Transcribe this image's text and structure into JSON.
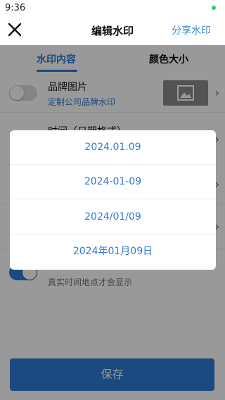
{
  "status_bar": {
    "time": "9:36"
  },
  "nav": {
    "title": "编辑水印",
    "share_label": "分享水印",
    "close_icon": "close-icon"
  },
  "tabs": {
    "active": "水印内容",
    "inactive": "颜色大小"
  },
  "rows": [
    {
      "label": "品牌图片",
      "sub": "定制公司品牌水印",
      "toggle_on": false
    },
    {
      "label": "时间（日期格式）"
    },
    {
      "sub": "真实时间地点才会显示",
      "toggle_on": true
    }
  ],
  "dialog": {
    "options": [
      "2024.01.09",
      "2024-01-09",
      "2024/01/09",
      "2024年01月09日"
    ]
  },
  "save_label": "保存",
  "colors": {
    "accent": "#2d7ad6",
    "overlay": "rgba(0,0,0,0.4)"
  }
}
